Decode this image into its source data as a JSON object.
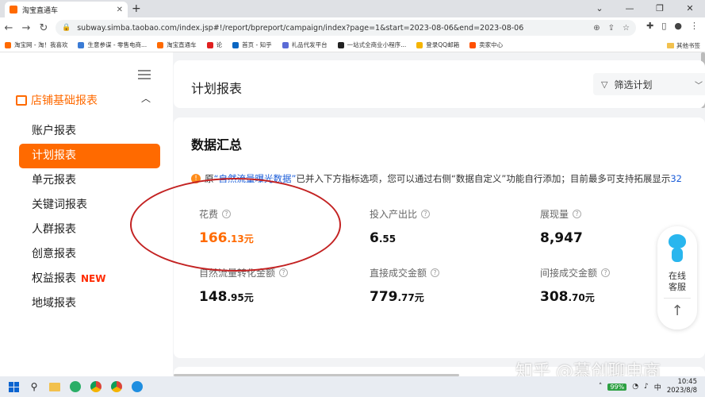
{
  "browser": {
    "tab_title": "淘宝直通车",
    "url": "subway.simba.taobao.com/index.jsp#!/report/bpreport/campaign/index?page=1&start=2023-08-06&end=2023-08-06",
    "bookmarks": [
      {
        "label": "淘宝网 - 淘！我喜欢",
        "color": "#ff6a00"
      },
      {
        "label": "生意参谋 - 零售电商...",
        "color": "#3a7bd5"
      },
      {
        "label": "淘宝直通车",
        "color": "#ff6a00"
      },
      {
        "label": "论",
        "color": "#e02020"
      },
      {
        "label": "首页 - 知乎",
        "color": "#0a66c2"
      },
      {
        "label": "礼品代发平台",
        "color": "#5b6bd6"
      },
      {
        "label": "一站式全商业小程序...",
        "color": "#222222"
      },
      {
        "label": "登录QQ邮箱",
        "color": "#f5b400"
      },
      {
        "label": "卖家中心",
        "color": "#ff5000"
      }
    ],
    "other_bookmarks": "其他书签"
  },
  "sidebar": {
    "group_label": "店铺基础报表",
    "items": [
      {
        "label": "账户报表",
        "active": false
      },
      {
        "label": "计划报表",
        "active": true
      },
      {
        "label": "单元报表",
        "active": false
      },
      {
        "label": "关键词报表",
        "active": false
      },
      {
        "label": "人群报表",
        "active": false
      },
      {
        "label": "创意报表",
        "active": false
      },
      {
        "label": "权益报表",
        "active": false,
        "badge": "NEW"
      },
      {
        "label": "地域报表",
        "active": false
      }
    ]
  },
  "header": {
    "title": "计划报表",
    "filter_label": "筛选计划"
  },
  "summary": {
    "title": "数据汇总",
    "notice_prefix": "原",
    "notice_highlight": "“自然流量曝光数据”",
    "notice_text": "已并入下方指标选项，您可以通过右侧“数据自定义”功能自行添加；目前最多可支持拓展显示",
    "notice_tail": "32",
    "metrics": [
      {
        "label": "花费",
        "int": "166",
        "dec": ".13",
        "unit": "元"
      },
      {
        "label": "投入产出比",
        "int": "6",
        "dec": ".55",
        "unit": ""
      },
      {
        "label": "展现量",
        "int": "8,947",
        "dec": "",
        "unit": ""
      },
      {
        "label": "自然流量转化金额",
        "int": "148",
        "dec": ".95",
        "unit": "元"
      },
      {
        "label": "直接成交金额",
        "int": "779",
        "dec": ".77",
        "unit": "元"
      },
      {
        "label": "间接成交金额",
        "int": "308",
        "dec": ".70",
        "unit": "元"
      }
    ]
  },
  "service": {
    "label_line1": "在线",
    "label_line2": "客服"
  },
  "watermark": "知乎 @慕创聊电商",
  "taskbar": {
    "battery": "99%",
    "time": "10:45",
    "date": "2023/8/8"
  }
}
